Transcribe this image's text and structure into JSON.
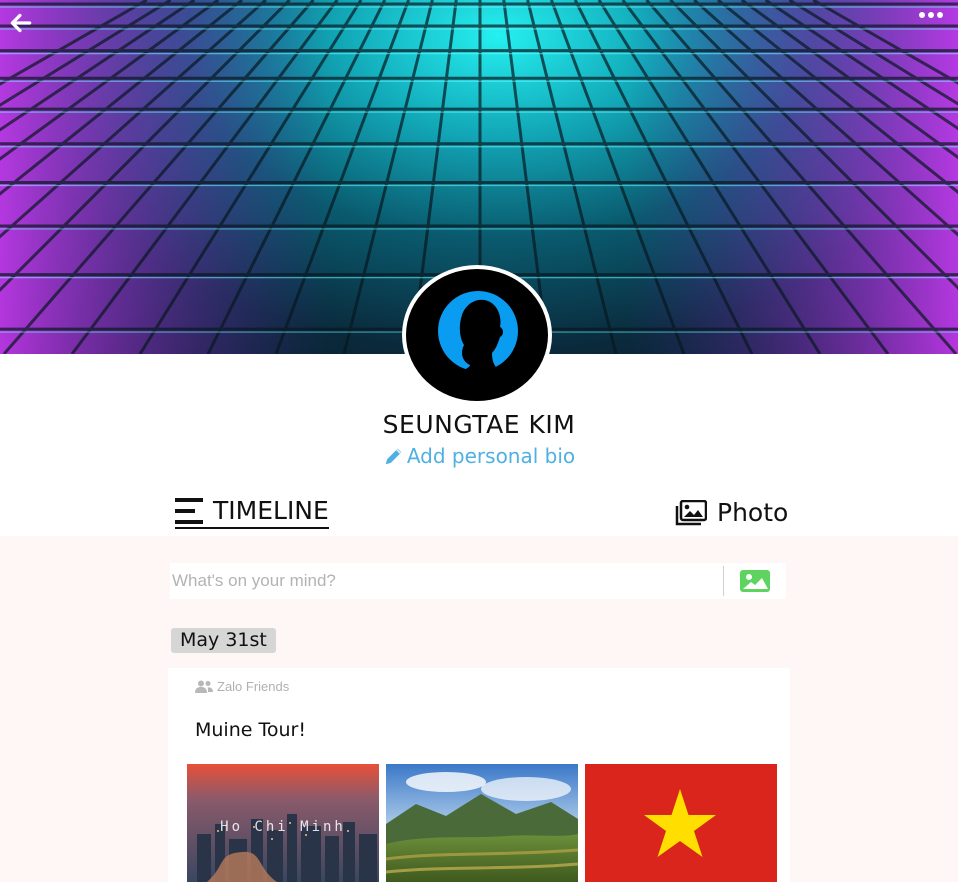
{
  "header": {
    "back_icon": "arrow-left-icon",
    "more_icon": "more-horizontal-icon"
  },
  "profile": {
    "name": "SEUNGTAE KIM",
    "bio_link": "Add personal bio",
    "bio_icon": "pencil-icon",
    "avatar_icon": "silhouette-avatar"
  },
  "tabs": {
    "timeline": "TIMELINE",
    "photo": "Photo"
  },
  "composer": {
    "placeholder": "What's on your mind?",
    "image_icon": "image-icon"
  },
  "feed": {
    "date": "May 31st",
    "posts": [
      {
        "privacy": "Zalo Friends",
        "privacy_icon": "friends-icon",
        "text": "Muine Tour!",
        "photos": [
          {
            "caption": "Ho Chi Minh",
            "kind": "city-skyline"
          },
          {
            "caption": "",
            "kind": "mountain-fields"
          },
          {
            "caption": "",
            "kind": "vietnam-flag"
          }
        ]
      }
    ]
  },
  "colors": {
    "accent": "#4fb0e3",
    "image_icon": "#5fd35f",
    "feed_bg": "#fff7f5",
    "date_badge": "#d6d6d6"
  }
}
